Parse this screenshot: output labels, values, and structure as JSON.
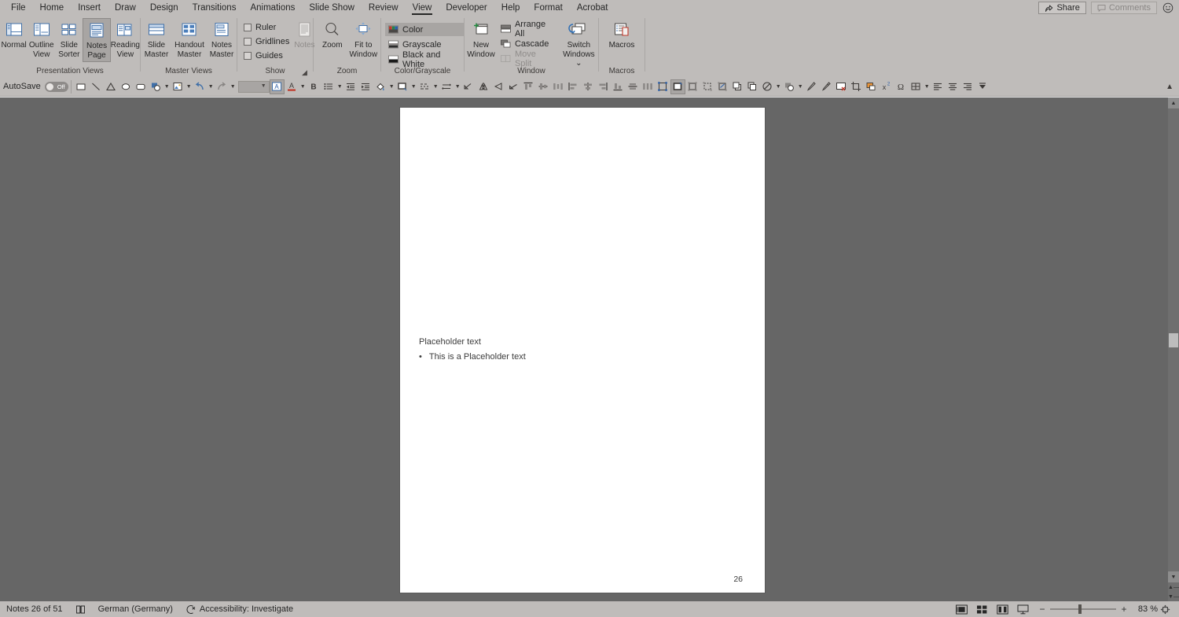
{
  "tabs": [
    {
      "label": "File",
      "active": false
    },
    {
      "label": "Home",
      "active": false
    },
    {
      "label": "Insert",
      "active": false
    },
    {
      "label": "Draw",
      "active": false
    },
    {
      "label": "Design",
      "active": false
    },
    {
      "label": "Transitions",
      "active": false
    },
    {
      "label": "Animations",
      "active": false
    },
    {
      "label": "Slide Show",
      "active": false
    },
    {
      "label": "Review",
      "active": false
    },
    {
      "label": "View",
      "active": true
    },
    {
      "label": "Developer",
      "active": false
    },
    {
      "label": "Help",
      "active": false
    },
    {
      "label": "Format",
      "active": false
    },
    {
      "label": "Acrobat",
      "active": false
    }
  ],
  "titlebar": {
    "share_label": "Share",
    "comments_label": "Comments",
    "emoji_icon": "smiley-face-icon"
  },
  "ribbon": {
    "groups": [
      {
        "name": "presentation-views",
        "label": "Presentation Views",
        "buttons": [
          {
            "label": "Normal",
            "icon": "normal-view-icon",
            "selected": false
          },
          {
            "label": "Outline View",
            "icon": "outline-view-icon",
            "selected": false
          },
          {
            "label": "Slide Sorter",
            "icon": "slide-sorter-icon",
            "selected": false
          },
          {
            "label": "Notes Page",
            "icon": "notes-page-icon",
            "selected": true
          },
          {
            "label": "Reading View",
            "icon": "reading-view-icon",
            "selected": false
          }
        ]
      },
      {
        "name": "master-views",
        "label": "Master Views",
        "buttons": [
          {
            "label": "Slide Master",
            "icon": "slide-master-icon",
            "selected": false
          },
          {
            "label": "Handout Master",
            "icon": "handout-master-icon",
            "selected": false
          },
          {
            "label": "Notes Master",
            "icon": "notes-master-icon",
            "selected": false
          }
        ]
      },
      {
        "name": "show",
        "label": "Show",
        "checkboxes": [
          {
            "label": "Ruler",
            "checked": false
          },
          {
            "label": "Gridlines",
            "checked": false
          },
          {
            "label": "Guides",
            "checked": false
          }
        ],
        "buttons": [
          {
            "label": "Notes",
            "icon": "notes-icon",
            "disabled": true
          }
        ],
        "dialog_launcher": true
      },
      {
        "name": "zoom",
        "label": "Zoom",
        "buttons": [
          {
            "label": "Zoom",
            "icon": "magnifier-icon",
            "selected": false
          },
          {
            "label": "Fit to Window",
            "icon": "fit-to-window-icon",
            "selected": false
          }
        ]
      },
      {
        "name": "color-grayscale",
        "label": "Color/Grayscale",
        "items": [
          {
            "label": "Color",
            "icon": "color-swatch-icon",
            "selected": true
          },
          {
            "label": "Grayscale",
            "icon": "grayscale-icon",
            "selected": false
          },
          {
            "label": "Black and White",
            "icon": "black-and-white-icon",
            "selected": false
          }
        ]
      },
      {
        "name": "window",
        "label": "Window",
        "buttons": [
          {
            "label": "New Window",
            "icon": "new-window-icon",
            "selected": false
          },
          {
            "label": "Switch Windows",
            "icon": "switch-windows-icon",
            "selected": false,
            "has_caret": true
          }
        ],
        "items": [
          {
            "label": "Arrange All",
            "icon": "arrange-all-icon",
            "disabled": false
          },
          {
            "label": "Cascade",
            "icon": "cascade-icon",
            "disabled": false
          },
          {
            "label": "Move Split",
            "icon": "move-split-icon",
            "disabled": true
          }
        ]
      },
      {
        "name": "macros",
        "label": "Macros",
        "buttons": [
          {
            "label": "Macros",
            "icon": "macros-icon",
            "selected": false
          }
        ]
      }
    ]
  },
  "quick_toolbar": {
    "autosave_label": "AutoSave",
    "autosave_state": "Off",
    "collapse_icon": "chevron-up-icon",
    "items": [
      {
        "icon": "rectangle-shape-icon",
        "caret": false,
        "selected": false,
        "disabled": false
      },
      {
        "icon": "line-shape-icon",
        "caret": false,
        "selected": false,
        "disabled": false
      },
      {
        "icon": "triangle-shape-icon",
        "caret": false,
        "selected": false,
        "disabled": false
      },
      {
        "icon": "ellipse-shape-icon",
        "caret": false,
        "selected": false,
        "disabled": false
      },
      {
        "icon": "rounded-rectangle-shape-icon",
        "caret": false,
        "selected": false,
        "disabled": false
      },
      {
        "icon": "shape-fill-icon",
        "caret": true,
        "selected": false,
        "disabled": false
      },
      {
        "icon": "insert-picture-icon",
        "caret": true,
        "selected": false,
        "disabled": false
      },
      {
        "icon": "undo-icon",
        "caret": true,
        "selected": false,
        "disabled": false
      },
      {
        "icon": "redo-icon",
        "caret": true,
        "selected": false,
        "disabled": true
      },
      {
        "icon": "style-combo-icon",
        "caret": false,
        "selected": false,
        "disabled": false
      },
      {
        "icon": "text-box-icon",
        "caret": false,
        "selected": true,
        "disabled": false
      },
      {
        "icon": "font-color-icon",
        "caret": true,
        "selected": false,
        "disabled": false
      },
      {
        "icon": "bold-icon",
        "caret": false,
        "selected": false,
        "disabled": false
      },
      {
        "icon": "bullet-list-icon",
        "caret": true,
        "selected": false,
        "disabled": false
      },
      {
        "icon": "decrease-indent-icon",
        "caret": false,
        "selected": false,
        "disabled": false
      },
      {
        "icon": "increase-indent-icon",
        "caret": false,
        "selected": false,
        "disabled": false
      },
      {
        "icon": "fill-color-icon",
        "caret": true,
        "selected": false,
        "disabled": false
      },
      {
        "icon": "line-style-icon",
        "caret": true,
        "selected": false,
        "disabled": false
      },
      {
        "icon": "line-dash-icon",
        "caret": true,
        "selected": false,
        "disabled": false
      },
      {
        "icon": "arrow-style-icon",
        "caret": true,
        "selected": false,
        "disabled": false
      },
      {
        "icon": "rotate-icon",
        "caret": false,
        "selected": false,
        "disabled": false
      },
      {
        "icon": "flip-vertical-icon",
        "caret": false,
        "selected": false,
        "disabled": false
      },
      {
        "icon": "flip-horizontal-icon",
        "caret": false,
        "selected": false,
        "disabled": false
      },
      {
        "icon": "rotate-left-icon",
        "caret": false,
        "selected": false,
        "disabled": false
      },
      {
        "icon": "align-top-icon",
        "caret": false,
        "selected": false,
        "disabled": false
      },
      {
        "icon": "align-middle-icon",
        "caret": false,
        "selected": false,
        "disabled": false
      },
      {
        "icon": "distribute-horizontal-icon",
        "caret": false,
        "selected": false,
        "disabled": false
      },
      {
        "icon": "align-left-edge-icon",
        "caret": false,
        "selected": false,
        "disabled": false
      },
      {
        "icon": "align-center-icon",
        "caret": false,
        "selected": false,
        "disabled": false
      },
      {
        "icon": "align-right-edge-icon",
        "caret": false,
        "selected": false,
        "disabled": false
      },
      {
        "icon": "align-bottom-icon",
        "caret": false,
        "selected": false,
        "disabled": false
      },
      {
        "icon": "distribute-vertical-icon",
        "caret": false,
        "selected": false,
        "disabled": false
      },
      {
        "icon": "distribute-spacing-icon",
        "caret": false,
        "selected": false,
        "disabled": false
      },
      {
        "icon": "selection-pane-icon",
        "caret": false,
        "selected": false,
        "disabled": false
      },
      {
        "icon": "shape-outline-icon",
        "caret": false,
        "selected": true,
        "disabled": false
      },
      {
        "icon": "group-objects-icon",
        "caret": false,
        "selected": false,
        "disabled": false
      },
      {
        "icon": "ungroup-objects-icon",
        "caret": false,
        "selected": false,
        "disabled": false
      },
      {
        "icon": "regroup-objects-icon",
        "caret": false,
        "selected": false,
        "disabled": false
      },
      {
        "icon": "bring-forward-icon",
        "caret": false,
        "selected": false,
        "disabled": false
      },
      {
        "icon": "send-backward-icon",
        "caret": false,
        "selected": false,
        "disabled": false
      },
      {
        "icon": "no-fill-icon",
        "caret": true,
        "selected": false,
        "disabled": false
      },
      {
        "icon": "shape-effects-icon",
        "caret": true,
        "selected": false,
        "disabled": false
      },
      {
        "icon": "format-painter-icon",
        "caret": false,
        "selected": false,
        "disabled": false
      },
      {
        "icon": "eyedropper-icon",
        "caret": false,
        "selected": false,
        "disabled": false
      },
      {
        "icon": "delete-slide-icon",
        "caret": false,
        "selected": false,
        "disabled": false
      },
      {
        "icon": "crop-icon",
        "caret": false,
        "selected": false,
        "disabled": false
      },
      {
        "icon": "duplicate-icon",
        "caret": false,
        "selected": false,
        "disabled": false
      },
      {
        "icon": "superscript-icon",
        "caret": false,
        "selected": false,
        "disabled": false
      },
      {
        "icon": "symbol-icon",
        "caret": false,
        "selected": false,
        "disabled": false
      },
      {
        "icon": "table-icon",
        "caret": true,
        "selected": false,
        "disabled": false
      },
      {
        "icon": "align-text-left-icon",
        "caret": false,
        "selected": false,
        "disabled": false
      },
      {
        "icon": "align-text-center-icon",
        "caret": false,
        "selected": false,
        "disabled": false
      },
      {
        "icon": "align-text-right-icon",
        "caret": false,
        "selected": false,
        "disabled": false
      },
      {
        "icon": "more-commands-icon",
        "caret": false,
        "selected": false,
        "disabled": false
      }
    ]
  },
  "slide": {
    "placeholder_title": "Placeholder text",
    "bullet_marker": "•",
    "bullet_text": "This is a Placeholder text",
    "page_number": "26"
  },
  "statusbar": {
    "slide_count": "Notes 26 of 51",
    "spellcheck_icon": "spellcheck-icon",
    "language": "German (Germany)",
    "accessibility_icon": "accessibility-icon",
    "accessibility": "Accessibility: Investigate",
    "views": [
      {
        "icon": "normal-view-icon",
        "name": "normal"
      },
      {
        "icon": "slide-sorter-icon",
        "name": "slide-sorter"
      },
      {
        "icon": "reading-view-icon",
        "name": "reading-view"
      },
      {
        "icon": "slide-show-icon",
        "name": "slide-show"
      }
    ],
    "zoom_out": "−",
    "zoom_in": "+",
    "zoom_level": "83 %",
    "fit_icon": "fit-slide-icon"
  },
  "colors": {
    "ribbon_bg": "#bfbcba",
    "workspace_bg": "#666666",
    "page_bg": "#ffffff",
    "accent_text": "#262626"
  }
}
